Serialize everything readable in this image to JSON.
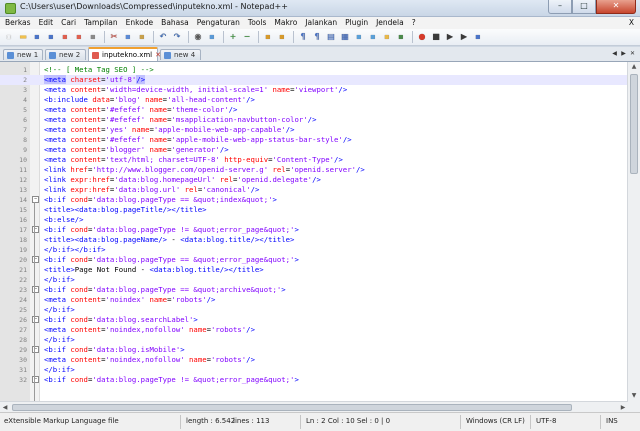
{
  "window": {
    "title": "C:\\Users\\user\\Downloads\\Compressed\\inputekno.xml - Notepad++",
    "min": "–",
    "max": "□",
    "close": "✕"
  },
  "menu": [
    "Berkas",
    "Edit",
    "Cari",
    "Tampilan",
    "Enkode",
    "Bahasa",
    "Pengaturan",
    "Tools",
    "Makro",
    "Jalankan",
    "Plugin",
    "Jendela",
    "?"
  ],
  "menu_close": "X",
  "tabs": [
    {
      "label": "new 1",
      "active": false,
      "icon_color": "#5a8fd6"
    },
    {
      "label": "new 2",
      "active": false,
      "icon_color": "#5a8fd6"
    },
    {
      "label": "inputekno.xml",
      "active": true,
      "icon_color": "#e05a4f"
    },
    {
      "label": "new 4",
      "active": false,
      "icon_color": "#5a8fd6"
    }
  ],
  "tab_close": "✕",
  "tab_nav": [
    "◀",
    "▶",
    "✕"
  ],
  "editor": {
    "current_line": 2,
    "lines": [
      {
        "n": "1",
        "tokens": [
          [
            "cm",
            "<!-- [ Meta Tag SEO ] -->"
          ]
        ]
      },
      {
        "n": "2",
        "tokens": [
          [
            "t",
            "<meta"
          ],
          [
            "tx",
            " "
          ],
          [
            "a",
            "charset"
          ],
          [
            "tx",
            "="
          ],
          [
            "v",
            "'utf-8'"
          ],
          [
            "t",
            "/>"
          ]
        ]
      },
      {
        "n": "3",
        "tokens": [
          [
            "t",
            "<meta"
          ],
          [
            "tx",
            " "
          ],
          [
            "a",
            "content"
          ],
          [
            "tx",
            "="
          ],
          [
            "v",
            "'width=device-width, initial-scale=1'"
          ],
          [
            "tx",
            " "
          ],
          [
            "a",
            "name"
          ],
          [
            "tx",
            "="
          ],
          [
            "v",
            "'viewport'"
          ],
          [
            "t",
            "/>"
          ]
        ]
      },
      {
        "n": "4",
        "tokens": [
          [
            "t",
            "<b:include"
          ],
          [
            "tx",
            " "
          ],
          [
            "a",
            "data"
          ],
          [
            "tx",
            "="
          ],
          [
            "v",
            "'blog'"
          ],
          [
            "tx",
            " "
          ],
          [
            "a",
            "name"
          ],
          [
            "tx",
            "="
          ],
          [
            "v",
            "'all-head-content'"
          ],
          [
            "t",
            "/>"
          ]
        ]
      },
      {
        "n": "5",
        "tokens": [
          [
            "t",
            "<meta"
          ],
          [
            "tx",
            " "
          ],
          [
            "a",
            "content"
          ],
          [
            "tx",
            "="
          ],
          [
            "v",
            "'#efefef'"
          ],
          [
            "tx",
            " "
          ],
          [
            "a",
            "name"
          ],
          [
            "tx",
            "="
          ],
          [
            "v",
            "'theme-color'"
          ],
          [
            "t",
            "/>"
          ]
        ]
      },
      {
        "n": "6",
        "tokens": [
          [
            "t",
            "<meta"
          ],
          [
            "tx",
            " "
          ],
          [
            "a",
            "content"
          ],
          [
            "tx",
            "="
          ],
          [
            "v",
            "'#efefef'"
          ],
          [
            "tx",
            " "
          ],
          [
            "a",
            "name"
          ],
          [
            "tx",
            "="
          ],
          [
            "v",
            "'msapplication-navbutton-color'"
          ],
          [
            "t",
            "/>"
          ]
        ]
      },
      {
        "n": "7",
        "tokens": [
          [
            "t",
            "<meta"
          ],
          [
            "tx",
            " "
          ],
          [
            "a",
            "content"
          ],
          [
            "tx",
            "="
          ],
          [
            "v",
            "'yes'"
          ],
          [
            "tx",
            " "
          ],
          [
            "a",
            "name"
          ],
          [
            "tx",
            "="
          ],
          [
            "v",
            "'apple-mobile-web-app-capable'"
          ],
          [
            "t",
            "/>"
          ]
        ]
      },
      {
        "n": "8",
        "tokens": [
          [
            "t",
            "<meta"
          ],
          [
            "tx",
            " "
          ],
          [
            "a",
            "content"
          ],
          [
            "tx",
            "="
          ],
          [
            "v",
            "'#efefef'"
          ],
          [
            "tx",
            " "
          ],
          [
            "a",
            "name"
          ],
          [
            "tx",
            "="
          ],
          [
            "v",
            "'apple-mobile-web-app-status-bar-style'"
          ],
          [
            "t",
            "/>"
          ]
        ]
      },
      {
        "n": "9",
        "tokens": [
          [
            "t",
            "<meta"
          ],
          [
            "tx",
            " "
          ],
          [
            "a",
            "content"
          ],
          [
            "tx",
            "="
          ],
          [
            "v",
            "'blogger'"
          ],
          [
            "tx",
            " "
          ],
          [
            "a",
            "name"
          ],
          [
            "tx",
            "="
          ],
          [
            "v",
            "'generator'"
          ],
          [
            "t",
            "/>"
          ]
        ]
      },
      {
        "n": "10",
        "tokens": [
          [
            "t",
            "<meta"
          ],
          [
            "tx",
            " "
          ],
          [
            "a",
            "content"
          ],
          [
            "tx",
            "="
          ],
          [
            "v",
            "'text/html; charset=UTF-8'"
          ],
          [
            "tx",
            " "
          ],
          [
            "a",
            "http-equiv"
          ],
          [
            "tx",
            "="
          ],
          [
            "v",
            "'Content-Type'"
          ],
          [
            "t",
            "/>"
          ]
        ]
      },
      {
        "n": "11",
        "tokens": [
          [
            "t",
            "<link"
          ],
          [
            "tx",
            " "
          ],
          [
            "a",
            "href"
          ],
          [
            "tx",
            "="
          ],
          [
            "v",
            "'http://www.blogger.com/openid-server.g'"
          ],
          [
            "tx",
            " "
          ],
          [
            "a",
            "rel"
          ],
          [
            "tx",
            "="
          ],
          [
            "v",
            "'openid.server'"
          ],
          [
            "t",
            "/>"
          ]
        ]
      },
      {
        "n": "12",
        "tokens": [
          [
            "t",
            "<link"
          ],
          [
            "tx",
            " "
          ],
          [
            "a",
            "expr:href"
          ],
          [
            "tx",
            "="
          ],
          [
            "v",
            "'data:blog.homepageUrl'"
          ],
          [
            "tx",
            " "
          ],
          [
            "a",
            "rel"
          ],
          [
            "tx",
            "="
          ],
          [
            "v",
            "'openid.delegate'"
          ],
          [
            "t",
            "/>"
          ]
        ]
      },
      {
        "n": "13",
        "tokens": [
          [
            "t",
            "<link"
          ],
          [
            "tx",
            " "
          ],
          [
            "a",
            "expr:href"
          ],
          [
            "tx",
            "="
          ],
          [
            "v",
            "'data:blog.url'"
          ],
          [
            "tx",
            " "
          ],
          [
            "a",
            "rel"
          ],
          [
            "tx",
            "="
          ],
          [
            "v",
            "'canonical'"
          ],
          [
            "t",
            "/>"
          ]
        ]
      },
      {
        "n": "14",
        "fold": "open",
        "tokens": [
          [
            "t",
            "<b:if"
          ],
          [
            "tx",
            " "
          ],
          [
            "a",
            "cond"
          ],
          [
            "tx",
            "="
          ],
          [
            "v",
            "'data:blog.pageType == &quot;index&quot;'"
          ],
          [
            "t",
            ">"
          ]
        ]
      },
      {
        "n": "15",
        "tokens": [
          [
            "t",
            "<title>"
          ],
          [
            "t",
            "<data:blog.pageTitle/>"
          ],
          [
            "t",
            "</title>"
          ]
        ]
      },
      {
        "n": "16",
        "tokens": [
          [
            "t",
            "<b:else/>"
          ]
        ]
      },
      {
        "n": "17",
        "fold": "open",
        "tokens": [
          [
            "t",
            "<b:if"
          ],
          [
            "tx",
            " "
          ],
          [
            "a",
            "cond"
          ],
          [
            "tx",
            "="
          ],
          [
            "v",
            "'data:blog.pageType != &quot;error_page&quot;'"
          ],
          [
            "t",
            ">"
          ]
        ]
      },
      {
        "n": "18",
        "tokens": [
          [
            "t",
            "<title>"
          ],
          [
            "t",
            "<data:blog.pageName/>"
          ],
          [
            "tx",
            " - "
          ],
          [
            "t",
            "<data:blog.title/>"
          ],
          [
            "t",
            "</title>"
          ]
        ]
      },
      {
        "n": "19",
        "fold": "end",
        "tokens": [
          [
            "t",
            "</b:if>"
          ],
          [
            "t",
            "</b:if>"
          ]
        ]
      },
      {
        "n": "20",
        "fold": "open",
        "tokens": [
          [
            "t",
            "<b:if"
          ],
          [
            "tx",
            " "
          ],
          [
            "a",
            "cond"
          ],
          [
            "tx",
            "="
          ],
          [
            "v",
            "'data:blog.pageType == &quot;error_page&quot;'"
          ],
          [
            "t",
            ">"
          ]
        ]
      },
      {
        "n": "21",
        "tokens": [
          [
            "t",
            "<title>"
          ],
          [
            "tx",
            "Page Not Found - "
          ],
          [
            "t",
            "<data:blog.title/>"
          ],
          [
            "t",
            "</title>"
          ]
        ]
      },
      {
        "n": "22",
        "fold": "end",
        "tokens": [
          [
            "t",
            "</b:if>"
          ]
        ]
      },
      {
        "n": "23",
        "fold": "open",
        "tokens": [
          [
            "t",
            "<b:if"
          ],
          [
            "tx",
            " "
          ],
          [
            "a",
            "cond"
          ],
          [
            "tx",
            "="
          ],
          [
            "v",
            "'data:blog.pageType == &quot;archive&quot;'"
          ],
          [
            "t",
            ">"
          ]
        ]
      },
      {
        "n": "24",
        "tokens": [
          [
            "t",
            "<meta"
          ],
          [
            "tx",
            " "
          ],
          [
            "a",
            "content"
          ],
          [
            "tx",
            "="
          ],
          [
            "v",
            "'noindex'"
          ],
          [
            "tx",
            " "
          ],
          [
            "a",
            "name"
          ],
          [
            "tx",
            "="
          ],
          [
            "v",
            "'robots'"
          ],
          [
            "t",
            "/>"
          ]
        ]
      },
      {
        "n": "25",
        "fold": "end",
        "tokens": [
          [
            "t",
            "</b:if>"
          ]
        ]
      },
      {
        "n": "26",
        "fold": "open",
        "tokens": [
          [
            "t",
            "<b:if"
          ],
          [
            "tx",
            " "
          ],
          [
            "a",
            "cond"
          ],
          [
            "tx",
            "="
          ],
          [
            "v",
            "'data:blog.searchLabel'"
          ],
          [
            "t",
            ">"
          ]
        ]
      },
      {
        "n": "27",
        "tokens": [
          [
            "t",
            "<meta"
          ],
          [
            "tx",
            " "
          ],
          [
            "a",
            "content"
          ],
          [
            "tx",
            "="
          ],
          [
            "v",
            "'noindex,nofollow'"
          ],
          [
            "tx",
            " "
          ],
          [
            "a",
            "name"
          ],
          [
            "tx",
            "="
          ],
          [
            "v",
            "'robots'"
          ],
          [
            "t",
            "/>"
          ]
        ]
      },
      {
        "n": "28",
        "fold": "end",
        "tokens": [
          [
            "t",
            "</b:if>"
          ]
        ]
      },
      {
        "n": "29",
        "fold": "open",
        "tokens": [
          [
            "t",
            "<b:if"
          ],
          [
            "tx",
            " "
          ],
          [
            "a",
            "cond"
          ],
          [
            "tx",
            "="
          ],
          [
            "v",
            "'data:blog.isMobile'"
          ],
          [
            "t",
            ">"
          ]
        ]
      },
      {
        "n": "30",
        "tokens": [
          [
            "t",
            "<meta"
          ],
          [
            "tx",
            " "
          ],
          [
            "a",
            "content"
          ],
          [
            "tx",
            "="
          ],
          [
            "v",
            "'noindex,nofollow'"
          ],
          [
            "tx",
            " "
          ],
          [
            "a",
            "name"
          ],
          [
            "tx",
            "="
          ],
          [
            "v",
            "'robots'"
          ],
          [
            "t",
            "/>"
          ]
        ]
      },
      {
        "n": "31",
        "fold": "end",
        "tokens": [
          [
            "t",
            "</b:if>"
          ]
        ]
      },
      {
        "n": "32",
        "fold": "open",
        "tokens": [
          [
            "t",
            "<b:if"
          ],
          [
            "tx",
            " "
          ],
          [
            "a",
            "cond"
          ],
          [
            "tx",
            "="
          ],
          [
            "v",
            "'data:blog.pageType != &quot;error_page&quot;'"
          ],
          [
            "t",
            ">"
          ]
        ]
      }
    ]
  },
  "status": {
    "file_type": "eXtensible Markup Language file",
    "length": "length : 6.542",
    "lines": "lines : 113",
    "position": "Ln : 2    Col : 10    Sel : 0 | 0",
    "eol": "Windows (CR LF)",
    "encoding": "UTF-8",
    "mode": "INS"
  },
  "toolbar_icons": [
    [
      "new-file-icon",
      "#ffffff",
      "▫"
    ],
    [
      "open-file-icon",
      "#f1c14e",
      "▬"
    ],
    [
      "save-icon",
      "#4a74c9",
      "▪"
    ],
    [
      "save-all-icon",
      "#4a74c9",
      "▪"
    ],
    [
      "close-icon",
      "#e06050",
      "▪"
    ],
    [
      "close-all-icon",
      "#e06050",
      "▪"
    ],
    [
      "print-icon",
      "#8a8a8a",
      "▪"
    ],
    [
      "sep"
    ],
    [
      "cut-icon",
      "#d24a3c",
      "✂"
    ],
    [
      "copy-icon",
      "#5b8ad6",
      "▪"
    ],
    [
      "paste-icon",
      "#c9a14b",
      "▪"
    ],
    [
      "sep"
    ],
    [
      "undo-icon",
      "#3c6fc2",
      "↶"
    ],
    [
      "redo-icon",
      "#3c6fc2",
      "↷"
    ],
    [
      "sep"
    ],
    [
      "find-icon",
      "#5a5a5a",
      "◉"
    ],
    [
      "replace-icon",
      "#5a9ad8",
      "▪"
    ],
    [
      "sep"
    ],
    [
      "zoom-in-icon",
      "#3b9a3b",
      "+"
    ],
    [
      "zoom-out-icon",
      "#3b9a3b",
      "−"
    ],
    [
      "sep"
    ],
    [
      "sync-vertical-icon",
      "#d89a2a",
      "▪"
    ],
    [
      "sync-horizontal-icon",
      "#d89a2a",
      "▪"
    ],
    [
      "sep"
    ],
    [
      "word-wrap-icon",
      "#4a74c9",
      "¶"
    ],
    [
      "show-all-chars-icon",
      "#4a74c9",
      "¶"
    ],
    [
      "indent-guide-icon",
      "#4a74c9",
      "▤"
    ],
    [
      "udl-icon",
      "#4a74c9",
      "▦"
    ],
    [
      "doc-map-icon",
      "#5aa0d8",
      "▪"
    ],
    [
      "function-list-icon",
      "#5aa0d8",
      "▪"
    ],
    [
      "folder-workspace-icon",
      "#e8b84a",
      "▪"
    ],
    [
      "monitor-icon",
      "#4a8a4a",
      "▪"
    ],
    [
      "sep"
    ],
    [
      "record-macro-icon",
      "#d63a2a",
      "●"
    ],
    [
      "stop-macro-icon",
      "#3a3a3a",
      "■"
    ],
    [
      "play-macro-icon",
      "#3a3a3a",
      "▶"
    ],
    [
      "run-macro-multiple-icon",
      "#3a3a3a",
      "▶"
    ],
    [
      "save-macro-icon",
      "#4a74c9",
      "▪"
    ]
  ]
}
